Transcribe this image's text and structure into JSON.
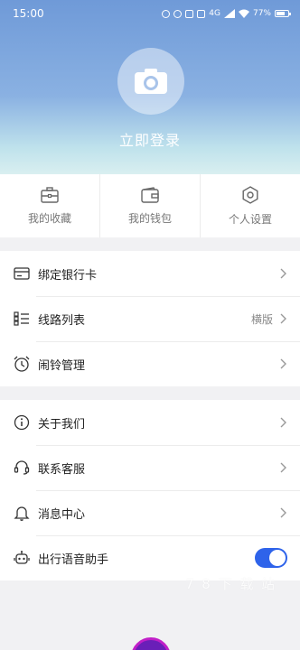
{
  "status_bar": {
    "time": "15:00",
    "battery": "77%",
    "network": "4G"
  },
  "header": {
    "login_label": "立即登录"
  },
  "quick_actions": [
    {
      "label": "我的收藏",
      "icon": "briefcase-icon"
    },
    {
      "label": "我的钱包",
      "icon": "wallet-icon"
    },
    {
      "label": "个人设置",
      "icon": "settings-icon"
    }
  ],
  "group1": [
    {
      "label": "绑定银行卡",
      "icon": "bank-card-icon"
    },
    {
      "label": "线路列表",
      "icon": "list-icon",
      "value": "横版"
    },
    {
      "label": "闹铃管理",
      "icon": "alarm-clock-icon"
    }
  ],
  "group2": [
    {
      "label": "关于我们",
      "icon": "info-icon"
    },
    {
      "label": "联系客服",
      "icon": "headset-icon"
    },
    {
      "label": "消息中心",
      "icon": "bell-icon"
    },
    {
      "label": "出行语音助手",
      "icon": "robot-icon",
      "toggle_on": true
    }
  ],
  "watermark": "7 8 下 载 站",
  "colors": {
    "accent": "#2e63ea",
    "header_top": "#6f9ad8",
    "header_bottom": "#d9eff0"
  }
}
